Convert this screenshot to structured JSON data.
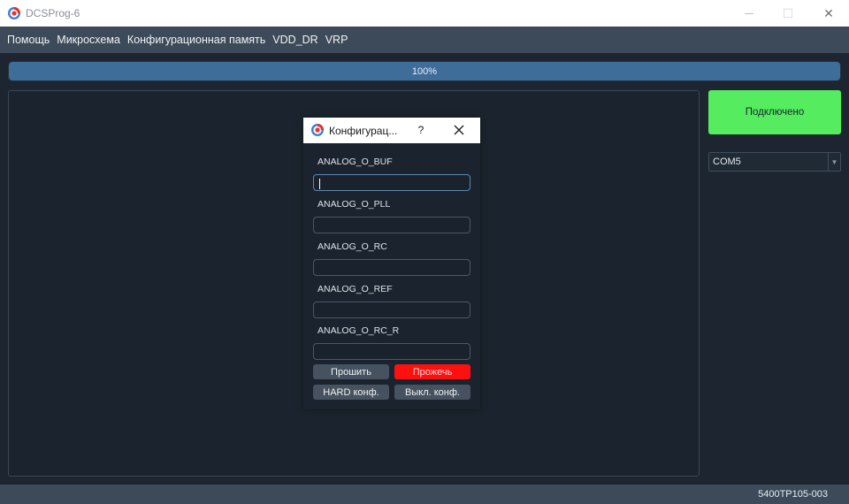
{
  "window": {
    "title": "DCSProg-6",
    "controls": {
      "minimize": "—",
      "maximize": "☐",
      "close": "✕"
    }
  },
  "menu": {
    "items": [
      "Помощь",
      "Микросхема",
      "Конфигурационная память",
      "VDD_DR",
      "VRP"
    ]
  },
  "progress": {
    "value": 100,
    "label": "100%"
  },
  "right_panel": {
    "connect_label": "Подключено",
    "port": {
      "selected": "COM5"
    }
  },
  "status": {
    "text": "5400TP105-003"
  },
  "dialog": {
    "title": "Конфигурац...",
    "help": "?",
    "fields": [
      {
        "label": "ANALOG_O_BUF",
        "value": ""
      },
      {
        "label": "ANALOG_O_PLL",
        "value": ""
      },
      {
        "label": "ANALOG_O_RC",
        "value": ""
      },
      {
        "label": "ANALOG_O_REF",
        "value": ""
      },
      {
        "label": "ANALOG_O_RC_R",
        "value": ""
      }
    ],
    "buttons": {
      "flash": "Прошить",
      "burn": "Прожечь",
      "hard_conf": "HARD конф.",
      "off_conf": "Выкл. конф."
    }
  },
  "colors": {
    "background": "#1c2530",
    "menubar": "#3c4a59",
    "progress_fill": "#3f6d9a",
    "connected": "#55ec5f",
    "burn_button": "#ff1010",
    "grey_button": "#46525f"
  },
  "icons": {
    "app": "dcsprog-logo-icon",
    "dialog": "dcsprog-logo-icon",
    "close": "close-icon",
    "dropdown": "chevron-down-icon"
  }
}
